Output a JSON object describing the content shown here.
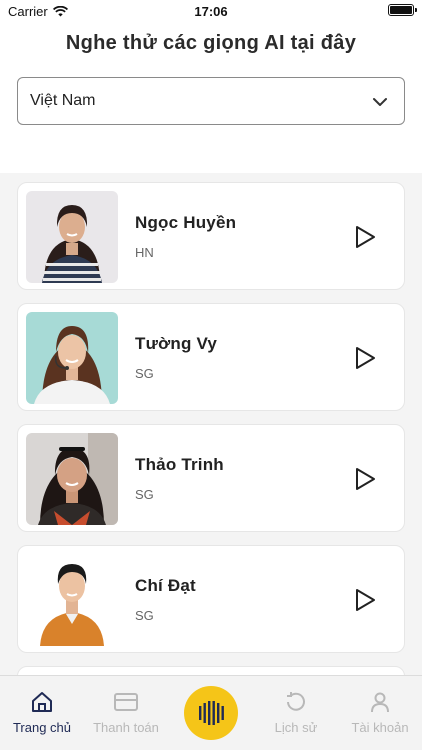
{
  "status_bar": {
    "carrier": "Carrier",
    "time": "17:06"
  },
  "title": "Nghe thử các giọng AI tại đây",
  "region_select": {
    "value": "Việt Nam"
  },
  "voices": [
    {
      "name": "Ngọc Huyền",
      "region": "HN"
    },
    {
      "name": "Tường Vy",
      "region": "SG"
    },
    {
      "name": "Thảo Trinh",
      "region": "SG"
    },
    {
      "name": "Chí Đạt",
      "region": "SG"
    }
  ],
  "bottom_nav": {
    "home": "Trang chủ",
    "payment": "Thanh toán",
    "history": "Lịch sử",
    "account": "Tài khoản"
  },
  "colors": {
    "accent": "#f5c518",
    "active_nav": "#1f2a55",
    "inactive_nav": "#b8b8b8"
  }
}
